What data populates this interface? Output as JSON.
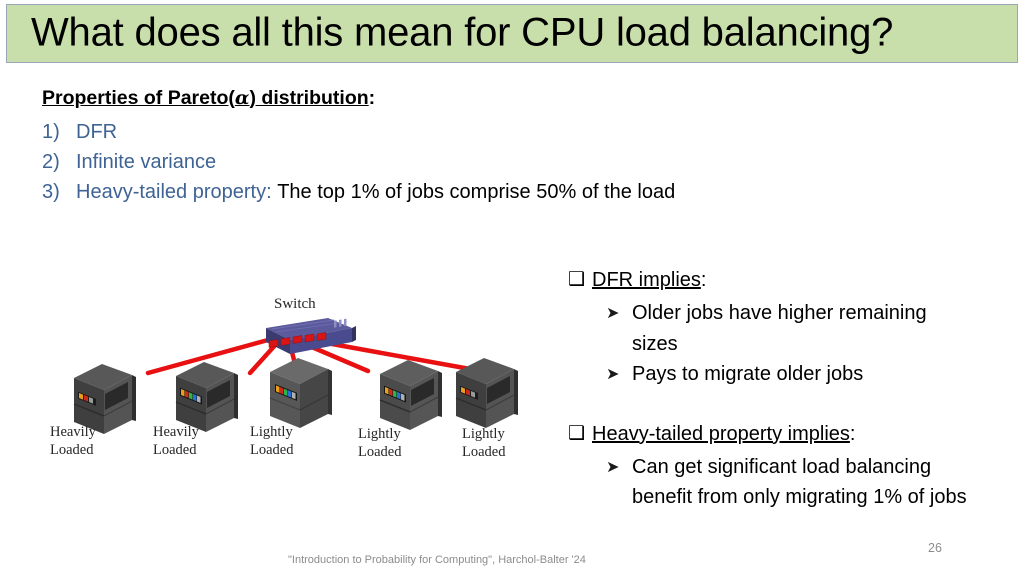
{
  "slide": {
    "title": "What does all this mean for CPU load balancing?",
    "title_bg_color": "#c9dfab",
    "accent_blue": "#3e6394"
  },
  "properties": {
    "heading_prefix": "Properties of Pareto(",
    "heading_symbol": "α",
    "heading_suffix": ") distribution",
    "heading_colon": ":",
    "items": [
      {
        "marker": "1)",
        "label": "DFR",
        "detail": ""
      },
      {
        "marker": "2)",
        "label": "Infinite variance",
        "detail": ""
      },
      {
        "marker": "3)",
        "label": "Heavy-tailed property:",
        "detail": "The top 1% of jobs comprise 50% of the load"
      }
    ]
  },
  "implications": [
    {
      "bullet_icon": "hollow-square-bullet",
      "heading": "DFR implies",
      "heading_colon": ":",
      "sub_items": [
        {
          "arrow_icon": "arrow-bullet",
          "text": "Older jobs have higher remaining sizes"
        },
        {
          "arrow_icon": "arrow-bullet",
          "text": "Pays to migrate older jobs"
        }
      ]
    },
    {
      "bullet_icon": "hollow-square-bullet",
      "heading": "Heavy-tailed property implies",
      "heading_colon": ":",
      "sub_items": [
        {
          "arrow_icon": "arrow-bullet",
          "text": "Can get significant load balancing benefit from only migrating 1% of jobs"
        }
      ]
    }
  ],
  "diagram": {
    "switch_label": "Switch",
    "servers": [
      {
        "label_line1": "Heavily",
        "label_line2": "Loaded",
        "load": "heavy"
      },
      {
        "label_line1": "Heavily",
        "label_line2": "Loaded",
        "load": "heavy"
      },
      {
        "label_line1": "Lightly",
        "label_line2": "Loaded",
        "load": "light"
      },
      {
        "label_line1": "Lightly",
        "label_line2": "Loaded",
        "load": "light"
      },
      {
        "label_line1": "Lightly",
        "label_line2": "Loaded",
        "load": "light"
      }
    ],
    "cable_color": "#e81010",
    "switch_color": "#4a4a8f"
  },
  "footer": {
    "citation": "\"Introduction to Probability for Computing\", Harchol-Balter '24",
    "page_number": "26"
  }
}
